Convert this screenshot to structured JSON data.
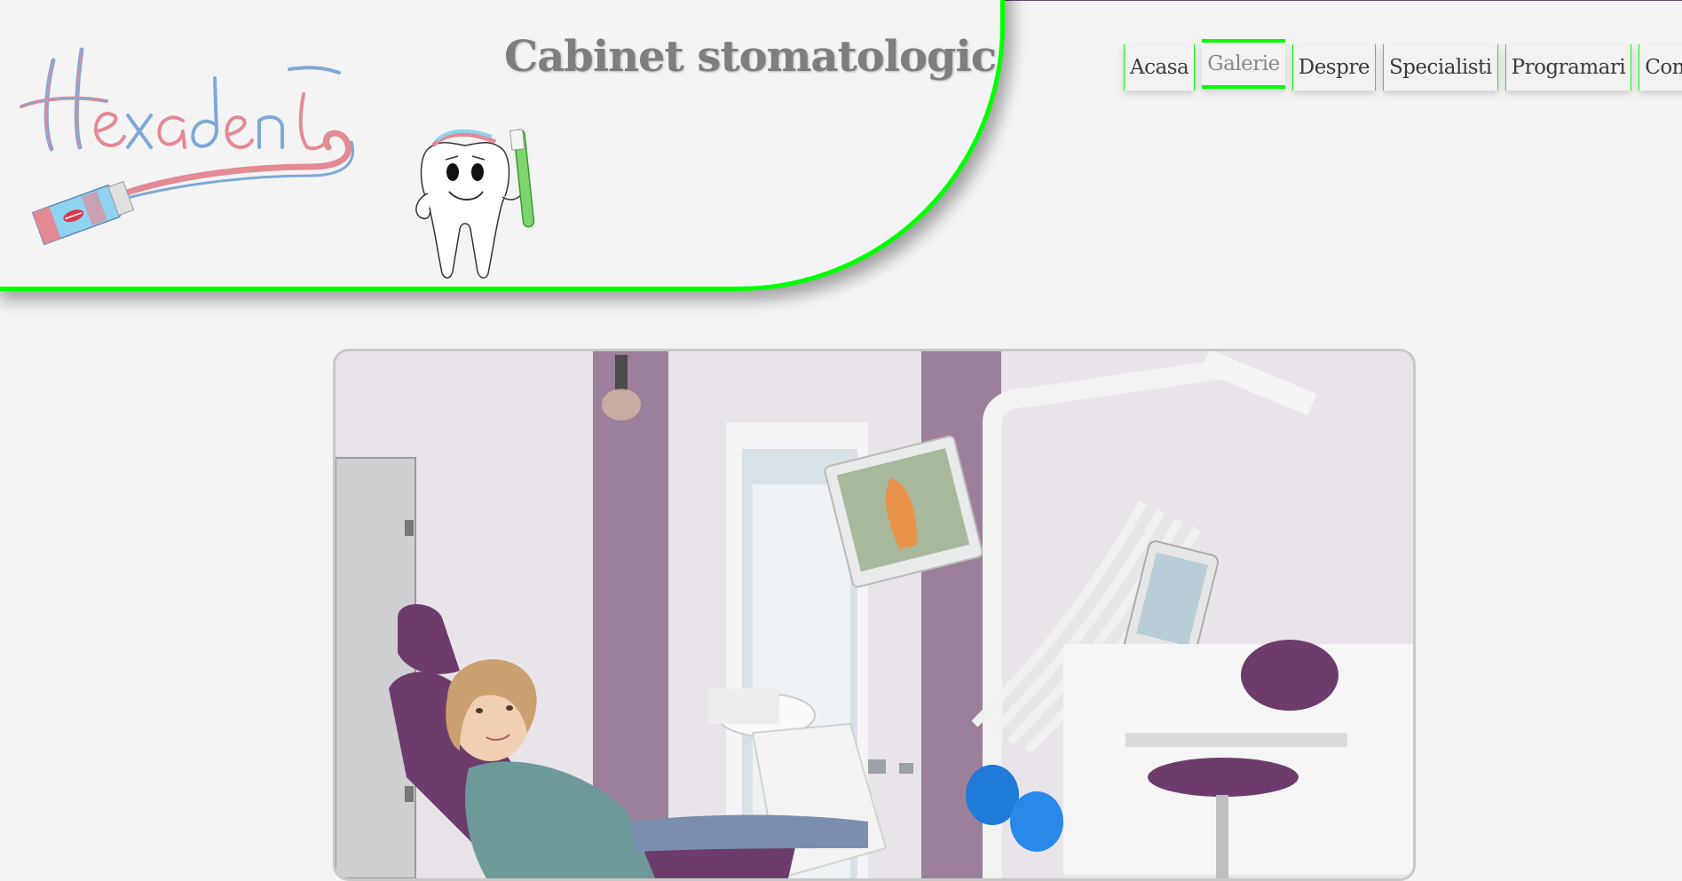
{
  "header": {
    "site_title": "Cabinet stomatologic",
    "logo_text": "Hexadent",
    "accent_color": "#00ff00"
  },
  "nav": {
    "items": [
      {
        "label": "Acasa",
        "active": false
      },
      {
        "label": "Galerie",
        "active": true
      },
      {
        "label": "Despre",
        "active": false
      },
      {
        "label": "Specialisti",
        "active": false
      },
      {
        "label": "Programari",
        "active": false
      },
      {
        "label": "Contact",
        "active": false
      }
    ]
  },
  "gallery": {
    "image_subject": "dental-office-photo"
  }
}
